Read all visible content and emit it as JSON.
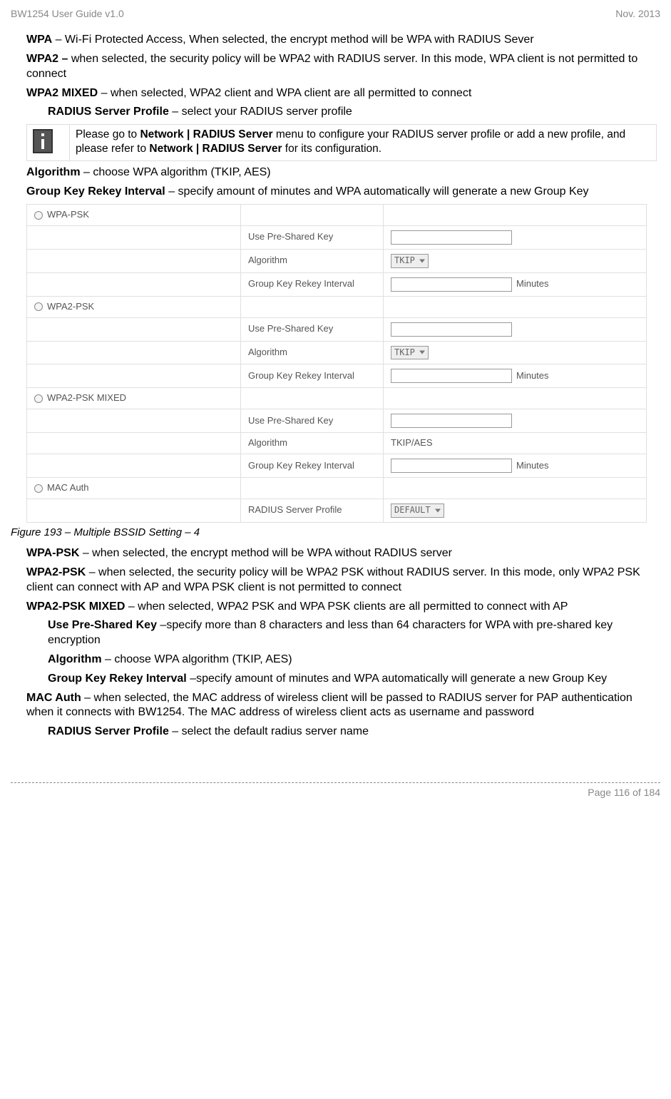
{
  "header": {
    "left": "BW1254 User Guide v1.0",
    "right": "Nov.  2013"
  },
  "p1_bold": "WPA",
  "p1_rest": " – Wi-Fi Protected Access, When selected, the encrypt method will be WPA with RADIUS Sever",
  "p2_bold": "WPA2 –",
  "p2_rest": " when selected, the security policy will be WPA2 with RADIUS server. In this mode, WPA client is not permitted to connect",
  "p3_bold": "WPA2 MIXED",
  "p3_rest": " – when selected, WPA2 client and WPA client are all permitted to connect",
  "p4_bold": "RADIUS Server Profile",
  "p4_rest": " – select your RADIUS server profile",
  "info_pre": "Please go to ",
  "info_b1": "Network | RADIUS Server",
  "info_mid": " menu to configure your RADIUS server profile or add a new profile, and please refer to ",
  "info_b2": "Network | RADIUS Server",
  "info_post": " for its configuration.",
  "p5_bold": "Algorithm",
  "p5_rest": " – choose WPA algorithm (TKIP, AES)",
  "p6_bold": "Group Key Rekey Interval",
  "p6_rest": " – specify amount of minutes and WPA automatically will generate a new Group Key",
  "chart_data": {
    "type": "table",
    "title": "Security options form",
    "rows": [
      {
        "radio": true,
        "radio_label": "WPA-PSK",
        "label": "",
        "control": ""
      },
      {
        "radio": false,
        "radio_label": "",
        "label": "Use Pre-Shared Key",
        "control": "text"
      },
      {
        "radio": false,
        "radio_label": "",
        "label": "Algorithm",
        "control": "select",
        "value": "TKIP"
      },
      {
        "radio": false,
        "radio_label": "",
        "label": "Group Key Rekey Interval",
        "control": "text",
        "suffix": "Minutes"
      },
      {
        "radio": true,
        "radio_label": "WPA2-PSK",
        "label": "",
        "control": ""
      },
      {
        "radio": false,
        "radio_label": "",
        "label": "Use Pre-Shared Key",
        "control": "text"
      },
      {
        "radio": false,
        "radio_label": "",
        "label": "Algorithm",
        "control": "select",
        "value": "TKIP"
      },
      {
        "radio": false,
        "radio_label": "",
        "label": "Group Key Rekey Interval",
        "control": "text",
        "suffix": "Minutes"
      },
      {
        "radio": true,
        "radio_label": "WPA2-PSK MIXED",
        "label": "",
        "control": ""
      },
      {
        "radio": false,
        "radio_label": "",
        "label": "Use Pre-Shared Key",
        "control": "text"
      },
      {
        "radio": false,
        "radio_label": "",
        "label": "Algorithm",
        "control": "static",
        "value": "TKIP/AES"
      },
      {
        "radio": false,
        "radio_label": "",
        "label": "Group Key Rekey Interval",
        "control": "text",
        "suffix": "Minutes"
      },
      {
        "radio": true,
        "radio_label": "MAC Auth",
        "label": "",
        "control": ""
      },
      {
        "radio": false,
        "radio_label": "",
        "label": "RADIUS Server Profile",
        "control": "select",
        "value": "DEFAULT"
      }
    ]
  },
  "figure_caption": "Figure 193 – Multiple BSSID Setting – 4",
  "p7_bold": "WPA-PSK",
  "p7_rest": " – when selected, the encrypt method will be WPA without RADIUS server",
  "p8_bold": "WPA2-PSK",
  "p8_rest": " – when selected, the security policy will be WPA2 PSK without RADIUS server. In this mode, only WPA2 PSK client can connect with AP and WPA PSK client is not permitted to connect",
  "p9_bold": "WPA2-PSK MIXED",
  "p9_rest": " – when selected, WPA2 PSK and WPA PSK clients are all permitted to connect with AP",
  "p10_bold": "Use Pre-Shared Key",
  "p10_rest": " –specify more than 8 characters and less than 64 characters for WPA with pre-shared key encryption",
  "p11_bold": "Algorithm",
  "p11_rest": " – choose WPA algorithm (TKIP, AES)",
  "p12_bold": "Group Key Rekey Interval",
  "p12_rest": " –specify amount of minutes and WPA automatically will generate a new Group Key",
  "p13_bold": "MAC Auth",
  "p13_rest": " – when selected, the MAC address of wireless client will be passed to RADIUS server for PAP authentication when it connects with BW1254. The MAC address of wireless client acts as username and password",
  "p14_bold": "RADIUS Server Profile",
  "p14_rest": " – select the default radius server name",
  "footer": "Page 116 of 184"
}
